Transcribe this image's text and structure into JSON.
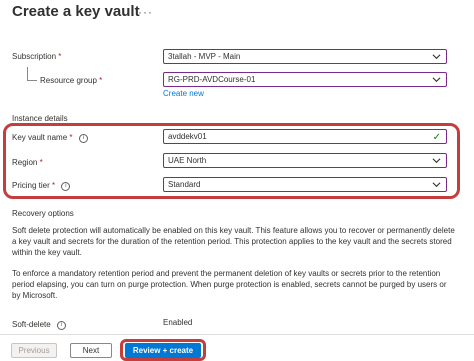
{
  "page": {
    "title": "Create a key vault",
    "more_label": "···"
  },
  "subscription": {
    "label": "Subscription",
    "required_mark": "*",
    "value": "3tallah - MVP - Main"
  },
  "resource_group": {
    "label": "Resource group",
    "required_mark": "*",
    "value": "RG-PRD-AVDCourse-01",
    "create_new": "Create new"
  },
  "instance_details": {
    "heading": "Instance details"
  },
  "key_vault_name": {
    "label": "Key vault name",
    "required_mark": "*",
    "value": "avddekv01",
    "valid_icon": "check-icon"
  },
  "region": {
    "label": "Region",
    "required_mark": "*",
    "value": "UAE North"
  },
  "pricing_tier": {
    "label": "Pricing tier",
    "required_mark": "*",
    "value": "Standard"
  },
  "recovery": {
    "heading": "Recovery options",
    "para1_lines": [
      "Soft delete protection will automatically be enabled on this key vault. This feature allows you to recover or permanently delete",
      "a key vault and secrets for the duration of the retention period. This protection applies to the key vault and the secrets stored",
      "within the key vault."
    ],
    "para2_lines": [
      "To enforce a mandatory retention period and prevent the permanent deletion of key vaults or secrets prior to the retention",
      "period elapsing, you can turn on purge protection. When purge protection is enabled, secrets cannot be purged by users or",
      "by Microsoft."
    ],
    "soft_delete_label": "Soft-delete",
    "soft_delete_value": "Enabled"
  },
  "footer": {
    "previous": "Previous",
    "next": "Next",
    "review_create": "Review + create"
  },
  "colors": {
    "accent": "#0078d4",
    "highlight": "#c43e3e",
    "select_border": "#7a2a8c",
    "valid": "#107c10"
  }
}
